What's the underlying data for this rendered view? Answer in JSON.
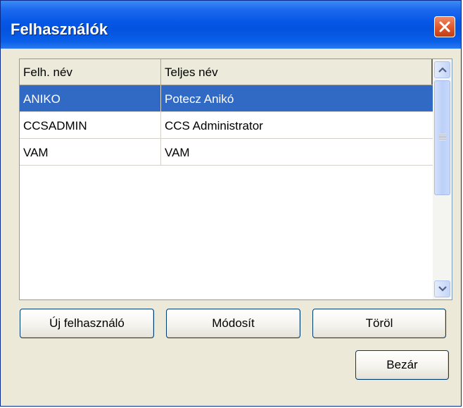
{
  "window": {
    "title": "Felhasználók"
  },
  "table": {
    "columns": [
      "Felh. név",
      "Teljes név"
    ],
    "rows": [
      {
        "username": "ANIKO",
        "fullname": "Potecz Anikó",
        "selected": true
      },
      {
        "username": "CCSADMIN",
        "fullname": "CCS Administrator",
        "selected": false
      },
      {
        "username": "VAM",
        "fullname": "VAM",
        "selected": false
      }
    ]
  },
  "actions": {
    "new_user": "Új felhasználó",
    "modify": "Módosít",
    "delete": "Töröl",
    "close": "Bezár"
  },
  "colors": {
    "titlebar": "#0656e6",
    "selection": "#316ac5",
    "close_button": "#e25a2e",
    "window_bg": "#ece9d8"
  },
  "icons": {
    "close": "close-icon",
    "scroll_up": "chevron-up-icon",
    "scroll_down": "chevron-down-icon"
  }
}
